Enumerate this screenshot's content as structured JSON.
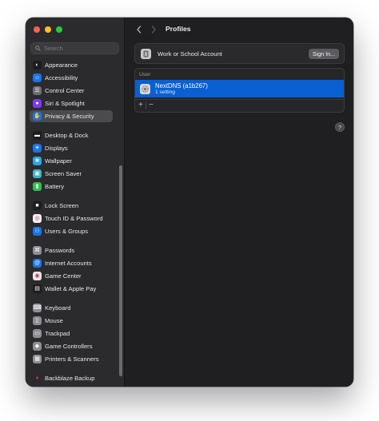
{
  "search": {
    "placeholder": "Search"
  },
  "sidebar": {
    "items": [
      {
        "label": "Appearance",
        "icon": "appearance-icon",
        "color": "#1c1c1e"
      },
      {
        "label": "Accessibility",
        "icon": "accessibility-icon",
        "color": "#1a73e8"
      },
      {
        "label": "Control Center",
        "icon": "control-center-icon",
        "color": "#6e6e73"
      },
      {
        "label": "Siri & Spotlight",
        "icon": "siri-icon",
        "color": "#7a3cf0"
      },
      {
        "label": "Privacy & Security",
        "icon": "hand-icon",
        "color": "#1a73e8",
        "selected": true
      },
      {
        "label": "Desktop & Dock",
        "icon": "dock-icon",
        "color": "#1c1c1e"
      },
      {
        "label": "Displays",
        "icon": "display-icon",
        "color": "#1a73e8"
      },
      {
        "label": "Wallpaper",
        "icon": "wallpaper-icon",
        "color": "#2fa3e6"
      },
      {
        "label": "Screen Saver",
        "icon": "screen-saver-icon",
        "color": "#3bb3c8"
      },
      {
        "label": "Battery",
        "icon": "battery-icon",
        "color": "#30c04f"
      },
      {
        "label": "Lock Screen",
        "icon": "lock-icon",
        "color": "#1c1c1e"
      },
      {
        "label": "Touch ID & Password",
        "icon": "fingerprint-icon",
        "color": "#f2f2f5"
      },
      {
        "label": "Users & Groups",
        "icon": "users-icon",
        "color": "#1a73e8"
      },
      {
        "label": "Passwords",
        "icon": "key-icon",
        "color": "#8e8e93"
      },
      {
        "label": "Internet Accounts",
        "icon": "at-icon",
        "color": "#1a73e8"
      },
      {
        "label": "Game Center",
        "icon": "game-center-icon",
        "color": "#e8e8ea"
      },
      {
        "label": "Wallet & Apple Pay",
        "icon": "wallet-icon",
        "color": "#1c1c1e"
      },
      {
        "label": "Keyboard",
        "icon": "keyboard-icon",
        "color": "#8e8e93"
      },
      {
        "label": "Mouse",
        "icon": "mouse-icon",
        "color": "#8e8e93"
      },
      {
        "label": "Trackpad",
        "icon": "trackpad-icon",
        "color": "#8e8e93"
      },
      {
        "label": "Game Controllers",
        "icon": "gamepad-icon",
        "color": "#8e8e93"
      },
      {
        "label": "Printers & Scanners",
        "icon": "printer-icon",
        "color": "#8e8e93"
      },
      {
        "label": "Backblaze Backup",
        "icon": "backblaze-icon",
        "color": "#2b2b2d"
      }
    ]
  },
  "main": {
    "title": "Profiles",
    "account": {
      "label": "Work or School Account",
      "button": "Sign In..."
    },
    "profiles": {
      "section": "User",
      "items": [
        {
          "name": "NextDNS (a1b267)",
          "detail": "1 setting"
        }
      ],
      "add": "+",
      "remove": "−"
    },
    "help": "?"
  },
  "colors": {
    "accent": "#0a5fd2",
    "window_bg": "#1f1f21",
    "sidebar_bg": "#2b2b2d"
  }
}
